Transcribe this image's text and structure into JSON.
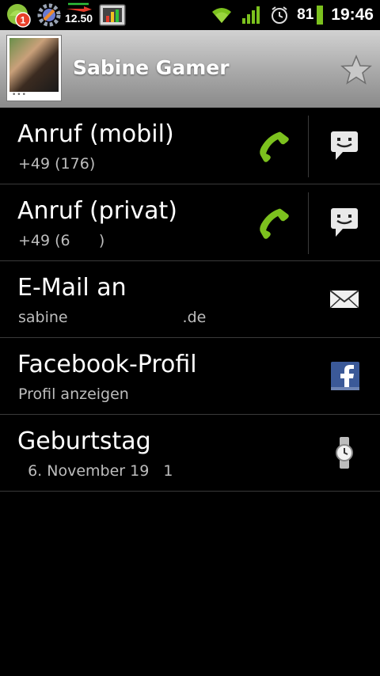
{
  "status_bar": {
    "notification_count": "1",
    "widget_value": "12.50",
    "battery_percent": "81",
    "time": "19:46"
  },
  "header": {
    "contact_name": "Sabine Gamer"
  },
  "rows": [
    {
      "title": "Anruf (mobil)",
      "subtitle": "+49 (176)",
      "primary_icon": "phone-icon",
      "secondary_icon": "sms-icon"
    },
    {
      "title": "Anruf (privat)",
      "subtitle": "+49 (6      )",
      "primary_icon": "phone-icon",
      "secondary_icon": "sms-icon"
    },
    {
      "title": "E-Mail an",
      "subtitle": "sabine                        .de",
      "secondary_icon": "email-icon"
    },
    {
      "title": "Facebook-Profil",
      "subtitle": "Profil anzeigen",
      "secondary_icon": "facebook-icon"
    },
    {
      "title": "Geburtstag",
      "subtitle": "  6. November 19   1",
      "secondary_icon": "watch-icon"
    }
  ],
  "colors": {
    "phone_green": "#7cc11e",
    "divider": "#3a3a3a",
    "subtitle_gray": "#bdbdbd",
    "facebook_blue": "#3b5998"
  }
}
